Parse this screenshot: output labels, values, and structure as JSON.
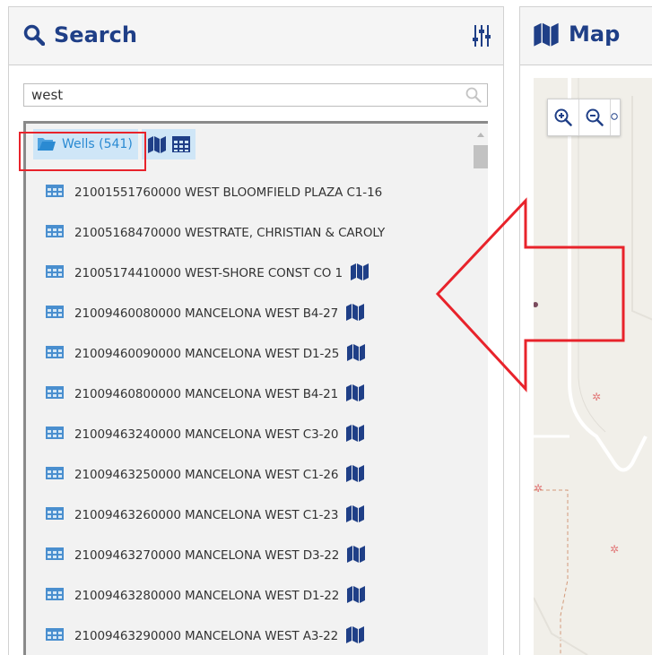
{
  "search_panel": {
    "title": "Search",
    "search": {
      "value": "west",
      "placeholder": ""
    },
    "group": {
      "label": "Wells (541)"
    },
    "items": [
      {
        "label": "21001551760000 WEST BLOOMFIELD PLAZA C1-16",
        "has_map": false
      },
      {
        "label": "21005168470000 WESTRATE, CHRISTIAN & CAROLY",
        "has_map": false
      },
      {
        "label": "21005174410000 WEST-SHORE CONST CO 1",
        "has_map": true
      },
      {
        "label": "21009460080000 MANCELONA WEST B4-27",
        "has_map": true
      },
      {
        "label": "21009460090000 MANCELONA WEST D1-25",
        "has_map": true
      },
      {
        "label": "21009460800000 MANCELONA WEST B4-21",
        "has_map": true
      },
      {
        "label": "21009463240000 MANCELONA WEST C3-20",
        "has_map": true
      },
      {
        "label": "21009463250000 MANCELONA WEST C1-26",
        "has_map": true
      },
      {
        "label": "21009463260000 MANCELONA WEST C1-23",
        "has_map": true
      },
      {
        "label": "21009463270000 MANCELONA WEST D3-22",
        "has_map": true
      },
      {
        "label": "21009463280000 MANCELONA WEST D1-22",
        "has_map": true
      },
      {
        "label": "21009463290000 MANCELONA WEST A3-22",
        "has_map": true
      }
    ]
  },
  "map_panel": {
    "title": "Map"
  },
  "icons": {
    "search": "magnifier-icon",
    "filter": "sliders-icon",
    "folder": "folder-open-icon",
    "map": "map-icon",
    "table": "table-icon",
    "zoom_in": "zoom-in-icon",
    "zoom_out": "zoom-out-icon"
  },
  "colors": {
    "brand_blue": "#1f3f87",
    "link_blue": "#2a8ad2",
    "highlight_bg": "#cfe6f7",
    "annotation_red": "#e8232b",
    "table_icon_blue": "#4a8fcf"
  }
}
